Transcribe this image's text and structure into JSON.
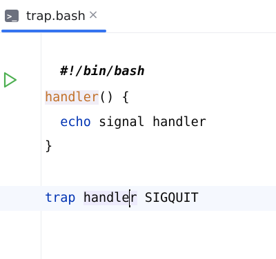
{
  "tab": {
    "icon": "bash-file-icon",
    "filename": "trap.bash",
    "close_glyph": "×",
    "accent": "#3574f0"
  },
  "gutter": {
    "run_icon": "run-icon",
    "run_color": "#4caf50"
  },
  "code": {
    "line1": "#!/bin/bash",
    "line3_fn": "handler",
    "line3_rest": "() {",
    "line4_indent": "  ",
    "line4_kw": "echo",
    "line4_rest": " signal handler",
    "line5": "}",
    "line7_kw": "trap",
    "line7_sp": " ",
    "line7_hl_a": "handle",
    "line7_hl_b": "r",
    "line7_rest": " SIGQUIT"
  }
}
